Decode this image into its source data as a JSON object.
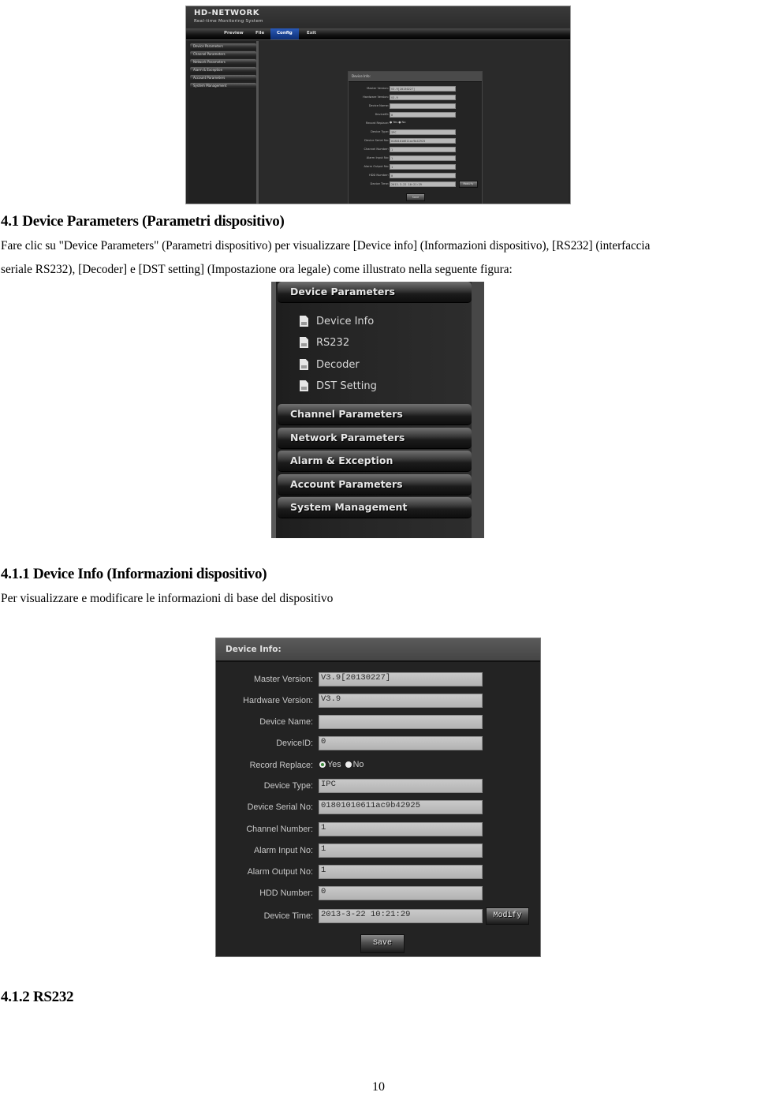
{
  "app_screenshot": {
    "logo": "HD-NETWORK",
    "subtitle": "Real-time Monitoring System",
    "menu": [
      {
        "label": "Preview",
        "active": false
      },
      {
        "label": "File",
        "active": false
      },
      {
        "label": "Config",
        "active": true
      },
      {
        "label": "Exit",
        "active": false
      }
    ],
    "sidebar": [
      "Device Parameters",
      "Channel Parameters",
      "Network Parameters",
      "Alarm & Exception",
      "Account Parameters",
      "System Management"
    ],
    "panel_title": "Device Info:",
    "fields": [
      {
        "label": "Master Version:",
        "value": "V3.9[20130227]"
      },
      {
        "label": "Hardware Version:",
        "value": "V3.9"
      },
      {
        "label": "Device Name:",
        "value": ""
      },
      {
        "label": "DeviceID:",
        "value": "0"
      },
      {
        "label": "Record Replace:",
        "type": "radio"
      },
      {
        "label": "Device Type:",
        "value": "IPC"
      },
      {
        "label": "Device Serial No:",
        "value": "01801010611ac9b42925"
      },
      {
        "label": "Channel Number:",
        "value": "1"
      },
      {
        "label": "Alarm Input No:",
        "value": "1"
      },
      {
        "label": "Alarm Output No:",
        "value": "1"
      },
      {
        "label": "HDD Number:",
        "value": "0"
      },
      {
        "label": "Device Time:",
        "value": "2013-3-22 10:21:29"
      }
    ],
    "radio_yes": "Yes",
    "radio_no": "No",
    "modify_label": "Modify",
    "save_label": "Save"
  },
  "section_4_1": {
    "heading": "4.1 Device Parameters (Parametri dispositivo)",
    "para_line1": "Fare clic su \"Device Parameters\" (Parametri dispositivo) per visualizzare [Device info] (Informazioni dispositivo), [RS232] (interfaccia",
    "para_line2": "seriale RS232), [Decoder] e [DST setting] (Impostazione ora legale) come illustrato nella seguente figura:"
  },
  "side_menu": {
    "header": "Device Parameters",
    "subitems": [
      "Device Info",
      "RS232",
      "Decoder",
      "DST Setting"
    ],
    "sections": [
      "Channel Parameters",
      "Network Parameters",
      "Alarm & Exception",
      "Account Parameters",
      "System Management"
    ]
  },
  "section_4_1_1": {
    "heading": "4.1.1 Device Info (Informazioni dispositivo)",
    "para": "Per visualizzare e modificare le informazioni di base del dispositivo"
  },
  "device_info": {
    "title": "Device Info:",
    "master_version": {
      "label": "Master Version:",
      "value": "V3.9[20130227]"
    },
    "hardware_version": {
      "label": "Hardware Version:",
      "value": "V3.9"
    },
    "device_name": {
      "label": "Device Name:",
      "value": ""
    },
    "device_id": {
      "label": "DeviceID:",
      "value": "0"
    },
    "record_replace": {
      "label": "Record Replace:",
      "yes": "Yes",
      "no": "No",
      "selected": "Yes"
    },
    "device_type": {
      "label": "Device Type:",
      "value": "IPC"
    },
    "serial_no": {
      "label": "Device Serial No:",
      "value": "01801010611ac9b42925"
    },
    "channel_number": {
      "label": "Channel Number:",
      "value": "1"
    },
    "alarm_input": {
      "label": "Alarm Input No:",
      "value": "1"
    },
    "alarm_output": {
      "label": "Alarm Output No:",
      "value": "1"
    },
    "hdd_number": {
      "label": "HDD Number:",
      "value": "0"
    },
    "device_time": {
      "label": "Device Time:",
      "value": "2013-3-22 10:21:29"
    },
    "modify_label": "Modify",
    "save_label": "Save"
  },
  "section_4_1_2": {
    "heading": "4.1.2 RS232"
  },
  "page_number": "10"
}
